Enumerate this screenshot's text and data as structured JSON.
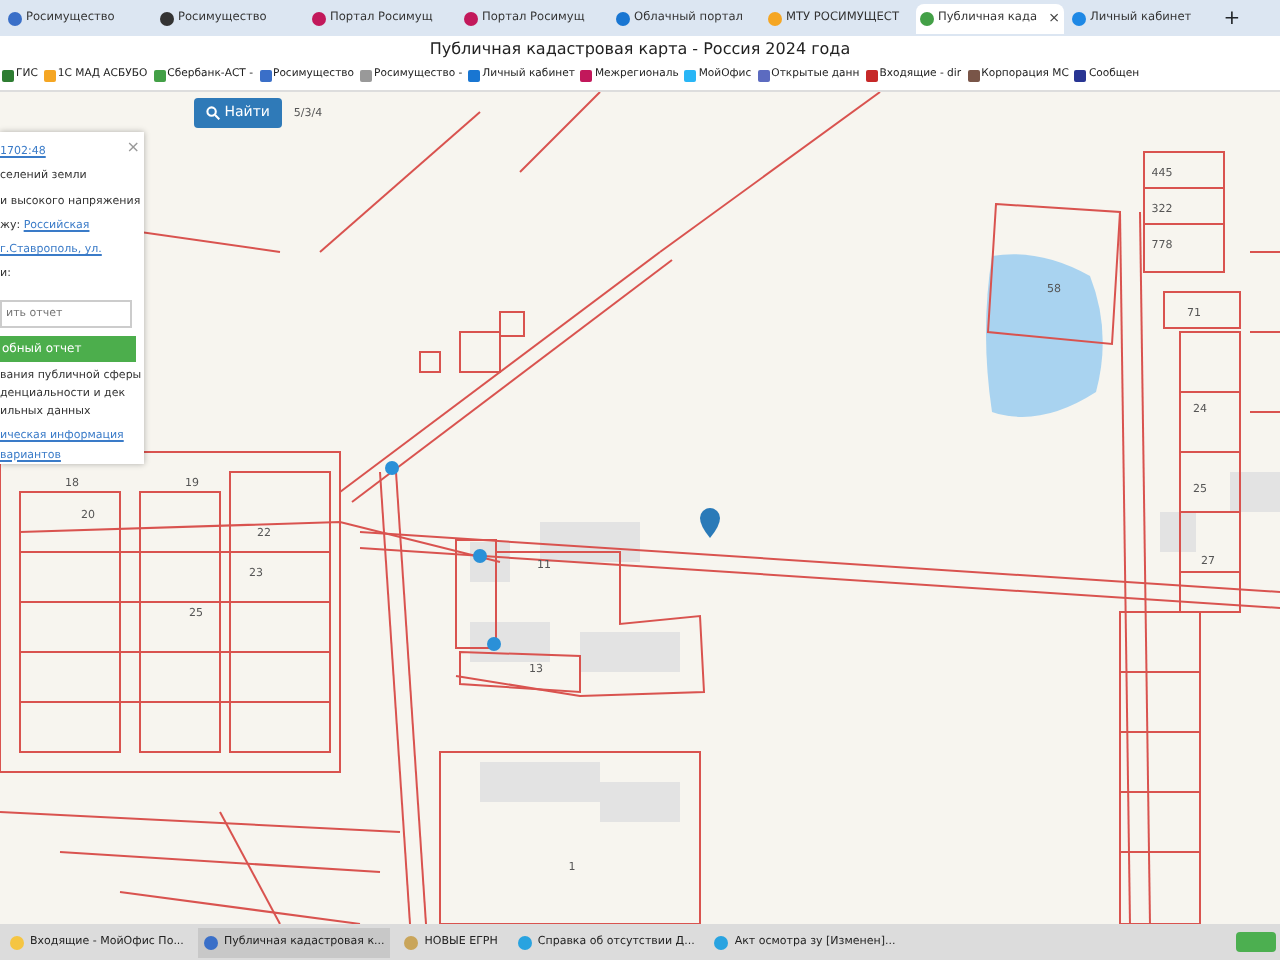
{
  "tabs": [
    {
      "label": "Росимущество",
      "selected": false
    },
    {
      "label": "Росимущество",
      "selected": false
    },
    {
      "label": "Портал Росимущ",
      "selected": false
    },
    {
      "label": "Портал Росимущ",
      "selected": false
    },
    {
      "label": "Облачный портал",
      "selected": false
    },
    {
      "label": "МТУ РОСИМУЩЕСТ",
      "selected": false
    },
    {
      "label": "Публичная када",
      "selected": true
    },
    {
      "label": "Личный кабинет",
      "selected": false
    }
  ],
  "new_tab": "+",
  "close_tab": "×",
  "window": {
    "title": "Публичная кадастровая карта - Россия 2024 года"
  },
  "bookmarks": [
    "ГИС",
    "1С МАД АСБУБО",
    "Сбербанк-АСТ -",
    "Росимущество",
    "Росимущество -",
    "Личный кабинет",
    "Межрегиональ",
    "МойОфис",
    "Открытые данн",
    "Входящие - dir",
    "Корпорация МС",
    "Сообщен"
  ],
  "search_button": "Найти",
  "panel": {
    "close": "×",
    "lines": [
      {
        "kind": "link",
        "text": "1702:48"
      },
      {
        "kind": "text",
        "text": "селений земли"
      },
      {
        "kind": "text",
        "text": "и высокого напряжения"
      },
      {
        "kind": "text_link",
        "text": "жу:",
        "link": "Российская"
      },
      {
        "kind": "link",
        "text": "г.Ставрополь, ул."
      },
      {
        "kind": "text",
        "text": "и:"
      }
    ],
    "field": {
      "placeholder": "ить отчет"
    },
    "report_button": "обный отчет",
    "notes": [
      "вания публичной сферы",
      "денциальности и дек",
      "ильных данных"
    ],
    "links": [
      "ическая информация",
      "вариантов"
    ]
  },
  "map": {
    "labels": [
      "5/3/4",
      "445",
      "322",
      "778",
      "58",
      "71",
      "24",
      "25",
      "27",
      "18",
      "19",
      "20",
      "22",
      "23",
      "25",
      "11",
      "13",
      "1"
    ]
  },
  "taskbar": [
    "Входящие - МойОфис По...",
    "Публичная кадастровая к...",
    "НОВЫЕ ЕГРН",
    "Справка об отсутствии Д...",
    "Акт осмотра зу [Изменен]..."
  ]
}
